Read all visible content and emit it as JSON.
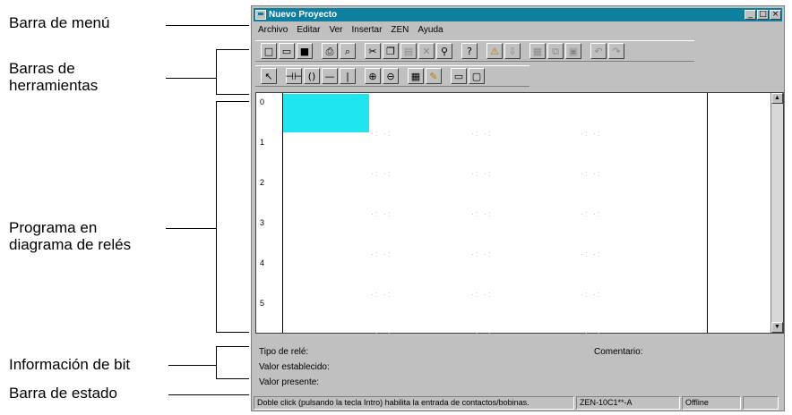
{
  "annotations": {
    "menu_bar": "Barra de menú",
    "toolbars": "Barras de\nherramientas",
    "ladder_program": "Programa en\ndiagrama de relés",
    "bit_info": "Información de bit",
    "status_bar": "Barra de estado"
  },
  "window": {
    "title": "Nuevo Proyecto",
    "controls": [
      "_",
      "□",
      "×"
    ]
  },
  "menu": [
    "Archivo",
    "Editar",
    "Ver",
    "Insertar",
    "ZEN",
    "Ayuda"
  ],
  "toolbar1": [
    {
      "icon": "new-file-icon",
      "glyph": "□"
    },
    {
      "icon": "open-folder-icon",
      "glyph": "▭"
    },
    {
      "icon": "save-icon",
      "glyph": "■"
    },
    {
      "icon": "print-icon",
      "glyph": "⎙"
    },
    {
      "icon": "print-preview-icon",
      "glyph": "⌕"
    },
    {
      "icon": "cut-icon",
      "glyph": "✂"
    },
    {
      "icon": "copy-icon",
      "glyph": "❐"
    },
    {
      "icon": "paste-icon",
      "glyph": "▤"
    },
    {
      "icon": "delete-icon",
      "glyph": "✕"
    },
    {
      "icon": "find-icon",
      "glyph": "⚲"
    },
    {
      "icon": "help-icon",
      "glyph": "?"
    },
    {
      "icon": "warning-icon",
      "glyph": "⚠"
    },
    {
      "icon": "transfer-icon",
      "glyph": "⇩"
    },
    {
      "icon": "monitor-icon",
      "glyph": "▦"
    },
    {
      "icon": "compare-icon",
      "glyph": "⧉"
    },
    {
      "icon": "program-icon",
      "glyph": "▣"
    },
    {
      "icon": "undo-icon",
      "glyph": "↶"
    },
    {
      "icon": "redo-icon",
      "glyph": "↷"
    }
  ],
  "toolbar2": [
    {
      "icon": "pointer-icon",
      "glyph": "↖"
    },
    {
      "icon": "contact-icon",
      "glyph": "⊣⊢"
    },
    {
      "icon": "coil-icon",
      "glyph": "()"
    },
    {
      "icon": "horizontal-line-icon",
      "glyph": "—"
    },
    {
      "icon": "vertical-line-icon",
      "glyph": "|"
    },
    {
      "icon": "zoom-in-icon",
      "glyph": "⊕"
    },
    {
      "icon": "zoom-out-icon",
      "glyph": "⊖"
    },
    {
      "icon": "grid-icon",
      "glyph": "▦"
    },
    {
      "icon": "comment-icon",
      "glyph": "✎"
    },
    {
      "icon": "view-icon",
      "glyph": "▭"
    },
    {
      "icon": "window-icon",
      "glyph": "▢"
    }
  ],
  "ladder": {
    "rows": [
      "0",
      "1",
      "2",
      "3",
      "4",
      "5"
    ]
  },
  "bit_info": {
    "relay_type": "Tipo de relé:",
    "set_value": "Valor establecido:",
    "present_value": "Valor presente:",
    "comment": "Comentario:"
  },
  "status": {
    "hint": "Doble click (pulsando la tecla Intro) habilita la entrada de contactos/bobinas.",
    "model": "ZEN-10C1**-A",
    "mode": "Offline"
  },
  "colors": {
    "titlebar": "#0f7fa0",
    "cursor": "#1fe6ee",
    "window_face": "#c0c0c0"
  }
}
